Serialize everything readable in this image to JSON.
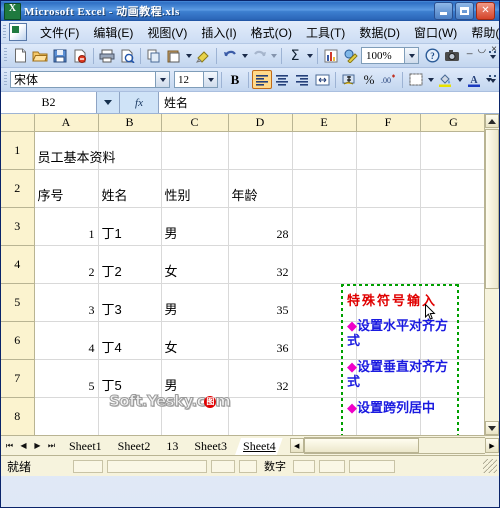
{
  "window": {
    "title": "Microsoft Excel - 动画教程.xls",
    "minimize_label": "最小化",
    "maximize_label": "最大化",
    "close_label": "关闭",
    "doc_minimize": "_",
    "doc_restore": "❐",
    "doc_close": "×"
  },
  "menu": {
    "items": [
      {
        "label": "文件(F)"
      },
      {
        "label": "编辑(E)"
      },
      {
        "label": "视图(V)"
      },
      {
        "label": "插入(I)"
      },
      {
        "label": "格式(O)"
      },
      {
        "label": "工具(T)"
      },
      {
        "label": "数据(D)"
      },
      {
        "label": "窗口(W)"
      },
      {
        "label": "帮助(H)"
      }
    ]
  },
  "standard_toolbar": {
    "buttons": [
      {
        "name": "new-icon",
        "glyph": "❐"
      },
      {
        "name": "open-icon",
        "glyph": "❐"
      },
      {
        "name": "save-icon",
        "glyph": "❐"
      },
      {
        "name": "permission-icon",
        "glyph": "❐"
      },
      {
        "name": "print-icon",
        "glyph": "❐"
      },
      {
        "name": "print-preview-icon",
        "glyph": "❐"
      },
      {
        "name": "copy-icon",
        "glyph": "❐"
      },
      {
        "name": "paste-icon",
        "glyph": "❐"
      },
      {
        "name": "format-painter-icon",
        "glyph": "❐"
      },
      {
        "name": "undo-icon",
        "glyph": "↶"
      },
      {
        "name": "redo-icon",
        "glyph": "↷"
      },
      {
        "name": "autosum-icon",
        "glyph": "Σ"
      },
      {
        "name": "chart-wizard-icon",
        "glyph": "❐"
      },
      {
        "name": "drawing-icon",
        "glyph": "❐"
      },
      {
        "name": "help-icon",
        "glyph": "?"
      },
      {
        "name": "camera-icon",
        "glyph": "❐"
      }
    ],
    "zoom_value": "100%"
  },
  "formatting_toolbar": {
    "font_name": "宋体",
    "font_size": "12",
    "bold_label": "B",
    "buttons": [
      {
        "name": "align-left-icon",
        "active": true
      },
      {
        "name": "align-center-icon",
        "active": false
      },
      {
        "name": "align-right-icon",
        "active": false
      },
      {
        "name": "merge-center-icon",
        "active": false
      },
      {
        "name": "currency-icon",
        "active": false
      },
      {
        "name": "percent-icon",
        "active": false
      },
      {
        "name": "comma-decrease-decimal-icon",
        "active": false
      },
      {
        "name": "borders-icon",
        "active": false
      },
      {
        "name": "fill-color-icon",
        "active": false
      },
      {
        "name": "font-color-icon",
        "active": false
      }
    ],
    "percent_glyph": "%"
  },
  "formula_bar": {
    "name_box_value": "B2",
    "fx_label": "fx",
    "formula_value": "姓名"
  },
  "sheet": {
    "column_headers": [
      "A",
      "B",
      "C",
      "D",
      "E",
      "F",
      "G"
    ],
    "row_headers": [
      "1",
      "2",
      "3",
      "4",
      "5",
      "6",
      "7",
      "8"
    ],
    "rows": [
      {
        "row": "1",
        "cells": [
          "员工基本资料",
          "",
          "",
          "",
          "",
          "",
          ""
        ],
        "numeric": [
          false,
          false,
          false,
          false,
          false,
          false,
          false
        ]
      },
      {
        "row": "2",
        "cells": [
          "序号",
          "姓名",
          "性别",
          "年龄",
          "",
          "",
          ""
        ],
        "numeric": [
          false,
          false,
          false,
          false,
          false,
          false,
          false
        ]
      },
      {
        "row": "3",
        "cells": [
          "1",
          "丁1",
          "男",
          "28",
          "",
          "",
          ""
        ],
        "numeric": [
          true,
          false,
          false,
          true,
          false,
          false,
          false
        ]
      },
      {
        "row": "4",
        "cells": [
          "2",
          "丁2",
          "女",
          "32",
          "",
          "",
          ""
        ],
        "numeric": [
          true,
          false,
          false,
          true,
          false,
          false,
          false
        ]
      },
      {
        "row": "5",
        "cells": [
          "3",
          "丁3",
          "男",
          "35",
          "",
          "",
          ""
        ],
        "numeric": [
          true,
          false,
          false,
          true,
          false,
          false,
          false
        ]
      },
      {
        "row": "6",
        "cells": [
          "4",
          "丁4",
          "女",
          "36",
          "",
          "",
          ""
        ],
        "numeric": [
          true,
          false,
          false,
          true,
          false,
          false,
          false
        ]
      },
      {
        "row": "7",
        "cells": [
          "5",
          "丁5",
          "男",
          "32",
          "",
          "",
          ""
        ],
        "numeric": [
          true,
          false,
          false,
          true,
          false,
          false,
          false
        ]
      },
      {
        "row": "8",
        "cells": [
          "",
          "",
          "",
          "",
          "",
          "",
          ""
        ],
        "numeric": [
          false,
          false,
          false,
          false,
          false,
          false,
          false
        ]
      }
    ]
  },
  "annotation": {
    "title": "特殊符号输入",
    "title_color": "#e00000",
    "item_color": "#1a1ae0",
    "bullet_color": "#f000c8",
    "border_color": "#00a000",
    "bullet": "◆",
    "items": [
      "设置水平对齐方式",
      "设置垂直对齐方式",
      "设置跨列居中"
    ]
  },
  "watermark": {
    "text_before": "Soft.Yesky.c",
    "logo_char": "图",
    "text_after": "m"
  },
  "sheet_tabs": {
    "first_label": "⏮",
    "prev_label": "◀",
    "next_label": "▶",
    "last_label": "⏭",
    "tabs": [
      {
        "label": "Sheet1",
        "active": false
      },
      {
        "label": "Sheet2",
        "active": false
      },
      {
        "label": "13",
        "active": false
      },
      {
        "label": "Sheet3",
        "active": false
      },
      {
        "label": "Sheet4",
        "active": true
      }
    ],
    "scroll_left": "◀",
    "scroll_right": "▶"
  },
  "status_bar": {
    "mode": "就绪",
    "num_lock": "数字"
  }
}
